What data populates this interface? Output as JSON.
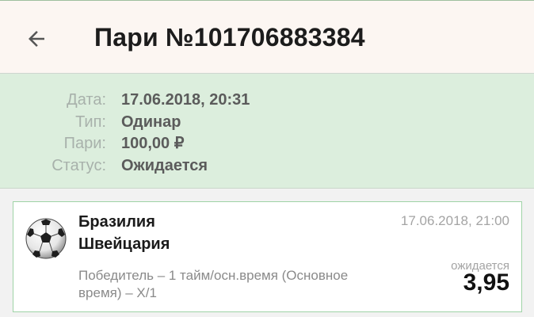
{
  "header": {
    "back_icon": "arrow-left-icon",
    "title": "Пари №101706883384"
  },
  "summary": {
    "rows": [
      {
        "label": "Дата:",
        "value": "17.06.2018, 20:31"
      },
      {
        "label": "Тип:",
        "value": "Одинар"
      },
      {
        "label": "Пари:",
        "value": "100,00 ₽"
      },
      {
        "label": "Статус:",
        "value": "Ожидается"
      }
    ]
  },
  "bet": {
    "sport_icon": "soccer-ball-icon",
    "team1": "Бразилия",
    "team2": "Швейцария",
    "event_datetime": "17.06.2018, 21:00",
    "market": "Победитель – 1 тайм/осн.время (Основное время) – Х/1",
    "status": "ожидается",
    "odds": "3,95"
  },
  "colors": {
    "app_bar_bg": "#fcf6f2",
    "summary_bg": "#dceedd",
    "card_border": "#9fd3a6"
  }
}
